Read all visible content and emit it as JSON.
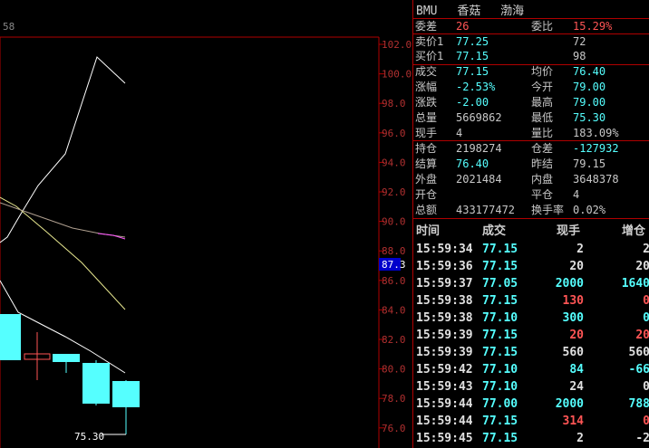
{
  "chart": {
    "corner_label": "58",
    "y_ticks": [
      "102.0",
      "100.0",
      "98.0",
      "96.0",
      "94.0",
      "92.0",
      "90.0",
      "88.0",
      "86.0",
      "84.0",
      "82.0",
      "80.0",
      "78.0",
      "76.0"
    ],
    "current_price_label": "87.3",
    "low_label": "75.30",
    "colors": {
      "grid": "#b00000",
      "up": "#55ffff",
      "down": "#ff5555",
      "line_white": "#ffffff",
      "line_yellow": "#e8e890",
      "line_magenta": "#ff55ff"
    }
  },
  "header": {
    "symbol": "BMU",
    "name": "香菇",
    "exchange": "渤海"
  },
  "quote": [
    {
      "l1": "委差",
      "v1": "26",
      "c1": "red",
      "l2": "委比",
      "v2": "15.29%",
      "c2": "red"
    },
    {
      "l1": "卖价1",
      "v1": "77.25",
      "c1": "cyan",
      "l2": "",
      "v2": "72",
      "c2": "grey"
    },
    {
      "l1": "买价1",
      "v1": "77.15",
      "c1": "cyan",
      "l2": "",
      "v2": "98",
      "c2": "grey"
    },
    {
      "l1": "成交",
      "v1": "77.15",
      "c1": "cyan",
      "l2": "均价",
      "v2": "76.40",
      "c2": "cyan"
    },
    {
      "l1": "涨幅",
      "v1": "-2.53%",
      "c1": "cyan",
      "l2": "今开",
      "v2": "79.00",
      "c2": "cyan"
    },
    {
      "l1": "涨跌",
      "v1": "-2.00",
      "c1": "cyan",
      "l2": "最高",
      "v2": "79.00",
      "c2": "cyan"
    },
    {
      "l1": "总量",
      "v1": "5669862",
      "c1": "grey",
      "l2": "最低",
      "v2": "75.30",
      "c2": "cyan"
    },
    {
      "l1": "现手",
      "v1": "4",
      "c1": "grey",
      "l2": "量比",
      "v2": "183.09%",
      "c2": "grey"
    },
    {
      "l1": "持仓",
      "v1": "2198274",
      "c1": "grey",
      "l2": "仓差",
      "v2": "-127932",
      "c2": "cyan"
    },
    {
      "l1": "结算",
      "v1": "76.40",
      "c1": "cyan",
      "l2": "昨结",
      "v2": "79.15",
      "c2": "grey"
    },
    {
      "l1": "外盘",
      "v1": "2021484",
      "c1": "grey",
      "l2": "内盘",
      "v2": "3648378",
      "c2": "grey"
    },
    {
      "l1": "开仓",
      "v1": "",
      "c1": "grey",
      "l2": "平仓",
      "v2": "4",
      "c2": "grey"
    },
    {
      "l1": "总额",
      "v1": "433177472",
      "c1": "grey",
      "l2": "换手率",
      "v2": "0.02%",
      "c2": "grey"
    }
  ],
  "ticks_header": {
    "time": "时间",
    "price": "成交",
    "vol": "现手",
    "oi": "增仓"
  },
  "ticks": [
    {
      "time": "15:59:34",
      "price": "77.15",
      "pc": "cyan",
      "vol": "2",
      "vc": "white",
      "oi": "2",
      "oc": "white"
    },
    {
      "time": "15:59:36",
      "price": "77.15",
      "pc": "cyan",
      "vol": "20",
      "vc": "white",
      "oi": "20",
      "oc": "white"
    },
    {
      "time": "15:59:37",
      "price": "77.05",
      "pc": "cyan",
      "vol": "2000",
      "vc": "cyan",
      "oi": "1640",
      "oc": "cyan"
    },
    {
      "time": "15:59:38",
      "price": "77.15",
      "pc": "cyan",
      "vol": "130",
      "vc": "red",
      "oi": "0",
      "oc": "red"
    },
    {
      "time": "15:59:38",
      "price": "77.10",
      "pc": "cyan",
      "vol": "300",
      "vc": "cyan",
      "oi": "0",
      "oc": "cyan"
    },
    {
      "time": "15:59:39",
      "price": "77.15",
      "pc": "cyan",
      "vol": "20",
      "vc": "red",
      "oi": "20",
      "oc": "red"
    },
    {
      "time": "15:59:39",
      "price": "77.15",
      "pc": "cyan",
      "vol": "560",
      "vc": "white",
      "oi": "560",
      "oc": "white"
    },
    {
      "time": "15:59:42",
      "price": "77.10",
      "pc": "cyan",
      "vol": "84",
      "vc": "cyan",
      "oi": "-66",
      "oc": "cyan"
    },
    {
      "time": "15:59:43",
      "price": "77.10",
      "pc": "cyan",
      "vol": "24",
      "vc": "white",
      "oi": "0",
      "oc": "white"
    },
    {
      "time": "15:59:44",
      "price": "77.00",
      "pc": "cyan",
      "vol": "2000",
      "vc": "cyan",
      "oi": "788",
      "oc": "cyan"
    },
    {
      "time": "15:59:44",
      "price": "77.15",
      "pc": "cyan",
      "vol": "314",
      "vc": "red",
      "oi": "0",
      "oc": "red"
    },
    {
      "time": "15:59:45",
      "price": "77.15",
      "pc": "cyan",
      "vol": "2",
      "vc": "white",
      "oi": "-2",
      "oc": "white"
    }
  ]
}
